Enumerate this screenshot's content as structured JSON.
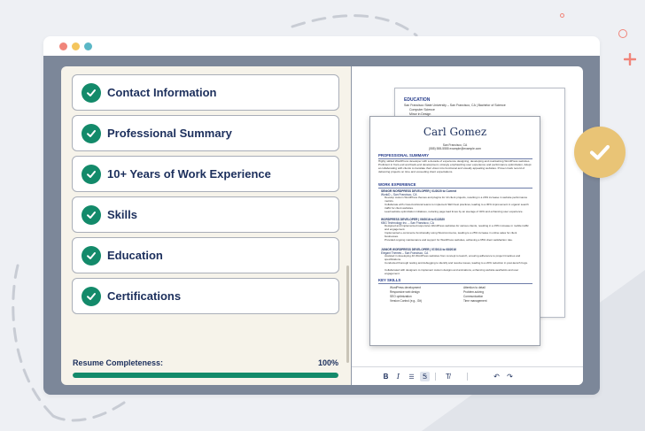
{
  "sections": [
    {
      "label": "Contact Information"
    },
    {
      "label": "Professional Summary"
    },
    {
      "label": "10+ Years of Work Experience"
    },
    {
      "label": "Skills"
    },
    {
      "label": "Education"
    },
    {
      "label": "Certifications"
    }
  ],
  "progress": {
    "label": "Resume Completeness:",
    "percent_text": "100%",
    "value": 100
  },
  "resume_back": {
    "education_title": "EDUCATION",
    "education_line": "San Francisco State University – San Francisco, CA | Bachelor of Science",
    "major": "Computer Science",
    "minor": "Minor in Design"
  },
  "resume": {
    "name": "Carl Gomez",
    "location": "San Francisco, CA",
    "contact": "(555) 555-5555  example@example.com",
    "summary_title": "PROFESSIONAL SUMMARY",
    "summary_text": "Highly skilled WordPress developer with a decade of experience designing, developing and maintaining WordPress websites. Proficient in front-end and back-end development, strongly emphasizing user experience and performance optimization. Adept at collaborating with clients to translate their vision into functional and visually appealing websites. Proven track record of delivering projects on time and exceeding client expectations.",
    "experience_title": "WORK EXPERIENCE",
    "jobs": [
      {
        "title": "SENIOR WORDPRESS DEVELOPER | 01/2020 to Current",
        "company": "WonkD – San Francisco, CA",
        "bullets": [
          "Develop custom WordPress themes and plugins for 10 client projects, resulting in a 20% increase in website performance metrics.",
          "Collaborate with cross-functional teams to implement SEO best practices, leading to a 30% improvement in organic search traffic for client websites.",
          "Lead website optimization initiatives, reducing page load times by an average of 40% and enhancing user experience."
        ]
      },
      {
        "title": "WORDPRESS DEVELOPER | 09/2016 to 01/2020",
        "company": "KBG Technology Inc. – San Francisco, CA",
        "bullets": [
          "Designed and implemented responsive WordPress websites for various clients, resulting in a 15% increase in mobile traffic and engagement.",
          "Implemented e-commerce functionality using WooCommerce, leading to a 25% increase in online sales for client businesses.",
          "Provided ongoing maintenance and support for WordPress websites, achieving a 95% client satisfaction rate."
        ]
      },
      {
        "title": "JUNIOR WORDPRESS DEVELOPER | 07/2013 to 08/2016",
        "company": "Elegant Themes – San Francisco, CA",
        "bullets": [
          "Assisted in developing 40 WordPress websites from concept to launch, ensuring adherence to project timelines and specifications.",
          "Conducted thorough testing and debugging to identify and resolve issues, leading to a 20% reduction in post-launch bugs.",
          "Collaborated with designers to implement custom designs and animations, enhancing website aesthetics and user engagement."
        ]
      }
    ],
    "skills_title": "KEY SKILLS",
    "skills": [
      "WordPress development",
      "Responsive web design",
      "SEO optimization",
      "Version Control (e.g., Git)",
      "Attention to detail",
      "Problem-solving",
      "Communication",
      "Time management"
    ]
  },
  "toolbar": {
    "bold": "B",
    "italic": "I",
    "list": "☰",
    "format": "Ꭶ",
    "clear": "T̸",
    "undo": "↶",
    "redo": "↷"
  },
  "colors": {
    "accent": "#138a6a",
    "navy": "#1c2f5c",
    "badge": "#e9c476",
    "coral": "#f0857a"
  }
}
